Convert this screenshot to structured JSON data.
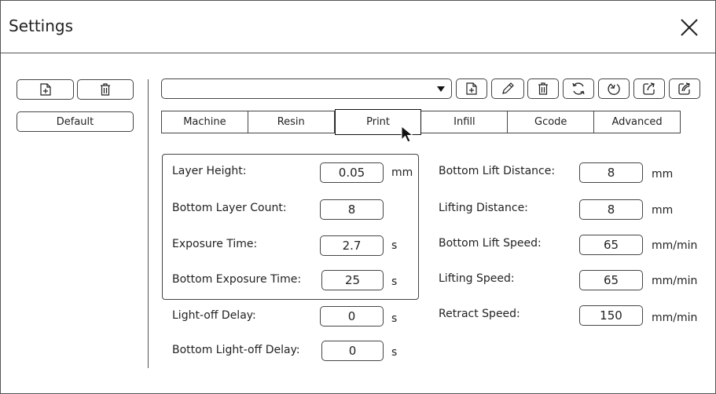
{
  "window": {
    "title": "Settings"
  },
  "left_panel": {
    "default_label": "Default"
  },
  "tabs": [
    "Machine",
    "Resin",
    "Print",
    "Infill",
    "Gcode",
    "Advanced"
  ],
  "active_tab": "Print",
  "left_fields": [
    {
      "label": "Layer Height:",
      "value": "0.05",
      "unit": "mm"
    },
    {
      "label": "Bottom Layer Count:",
      "value": "8",
      "unit": ""
    },
    {
      "label": "Exposure Time:",
      "value": "2.7",
      "unit": "s"
    },
    {
      "label": "Bottom Exposure Time:",
      "value": "25",
      "unit": "s"
    },
    {
      "label": "Light-off Delay:",
      "value": "0",
      "unit": "s"
    },
    {
      "label": "Bottom Light-off Delay:",
      "value": "0",
      "unit": "s"
    }
  ],
  "right_fields": [
    {
      "label": "Bottom Lift Distance:",
      "value": "8",
      "unit": "mm"
    },
    {
      "label": "Lifting Distance:",
      "value": "8",
      "unit": "mm"
    },
    {
      "label": "Bottom Lift Speed:",
      "value": "65",
      "unit": "mm/min"
    },
    {
      "label": "Lifting Speed:",
      "value": "65",
      "unit": "mm/min"
    },
    {
      "label": "Retract Speed:",
      "value": "150",
      "unit": "mm/min"
    }
  ],
  "icons": {
    "close": "close-icon",
    "new_profile": "file-add-icon",
    "delete": "trash-icon",
    "dropdown": "chevron-down-icon",
    "edit": "pencil-icon",
    "refresh": "refresh-icon",
    "import": "import-icon",
    "export": "export-icon",
    "export_all": "export-all-icon"
  }
}
